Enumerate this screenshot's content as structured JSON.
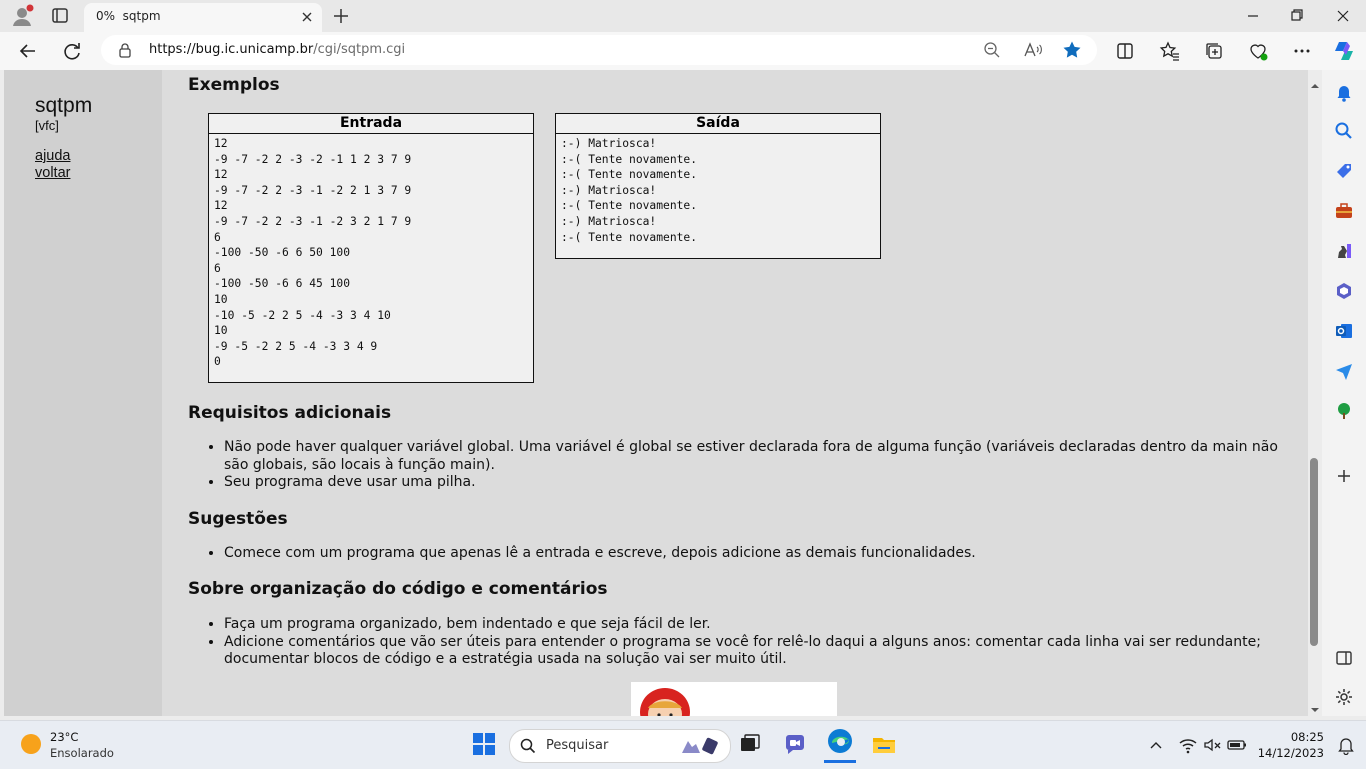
{
  "browser": {
    "tab": {
      "title": "0%  sqtpm"
    },
    "address": {
      "url_host": "https://bug.ic.unicamp.br",
      "url_path": "/cgi/sqtpm.cgi"
    }
  },
  "sidebar": {
    "title": "sqtpm",
    "user": "[vfc]",
    "links": [
      "ajuda",
      "voltar"
    ]
  },
  "examples": {
    "heading": "Exemplos",
    "input": {
      "header": "Entrada",
      "lines": [
        "12",
        "-9 -7 -2 2 -3 -2 -1 1 2 3 7 9",
        "12",
        "-9 -7 -2 2 -3 -1 -2 2 1 3 7 9",
        "12",
        "-9 -7 -2 2 -3 -1 -2 3 2 1 7 9",
        "6",
        "-100 -50 -6 6 50 100",
        "6",
        "-100 -50 -6 6 45 100",
        "10",
        "-10 -5 -2 2 5 -4 -3 3 4 10",
        "10",
        "-9 -5 -2 2 5 -4 -3 3 4 9",
        "0"
      ]
    },
    "output": {
      "header": "Saída",
      "lines": [
        ":-) Matriosca!",
        ":-( Tente novamente.",
        ":-( Tente novamente.",
        ":-) Matriosca!",
        ":-( Tente novamente.",
        ":-) Matriosca!",
        ":-( Tente novamente."
      ]
    }
  },
  "requirements": {
    "heading": "Requisitos adicionais",
    "items": [
      "Não pode haver qualquer variável global. Uma variável é global se estiver declarada fora de alguma função (variáveis declaradas dentro da main não são globais, são locais à função main).",
      "Seu programa deve usar uma pilha."
    ]
  },
  "suggestions": {
    "heading": "Sugestões",
    "items": [
      "Comece com um programa que apenas lê a entrada e escreve, depois adicione as demais funcionalidades."
    ]
  },
  "organization": {
    "heading": "Sobre organização do código e comentários",
    "items": [
      "Faça um programa organizado, bem indentado e que seja fácil de ler.",
      "Adicione comentários que vão ser úteis para entender o programa se você for relê-lo daqui a alguns anos: comentar cada linha vai ser redundante; documentar blocos de código e a estratégia usada na solução vai ser muito útil."
    ]
  },
  "taskbar": {
    "weather_temp": "23°C",
    "weather_desc": "Ensolarado",
    "search_placeholder": "Pesquisar",
    "time": "08:25",
    "date": "14/12/2023"
  },
  "colors": {
    "page_bg": "#dcdcdc",
    "sidebar_bg": "#d0d0d0",
    "box_bg": "#f0f0f0",
    "edge_accent": "#0f6cbd"
  },
  "scroll_position_fraction": 0.6
}
